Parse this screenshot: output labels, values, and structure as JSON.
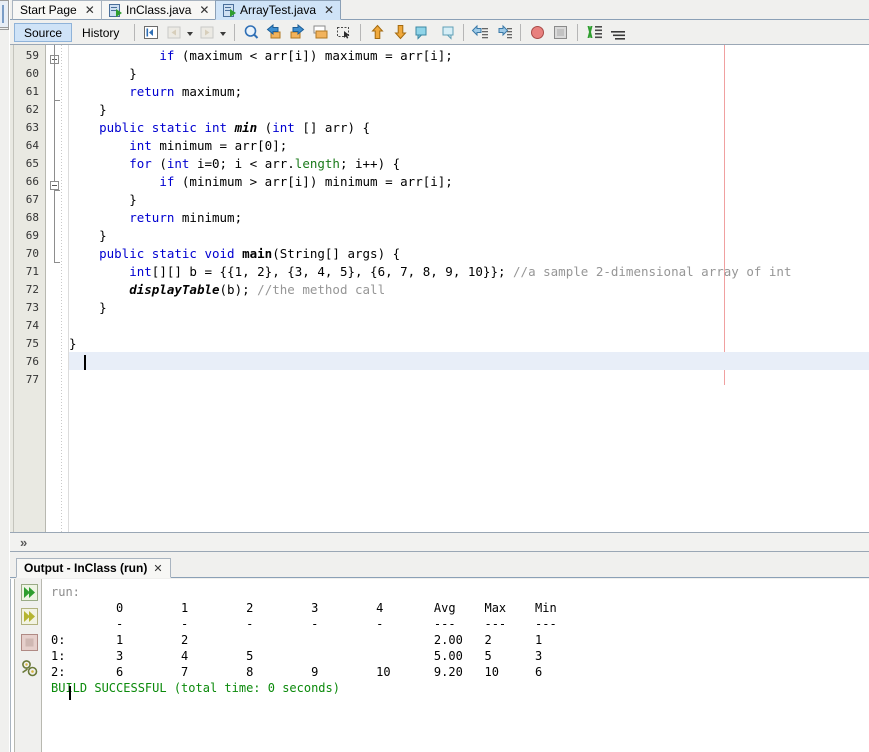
{
  "window": {
    "title": "NetBeans IDE - ArrayTest.java",
    "accent_color": "#cfe3f7",
    "gutter_color": "#e9e9e2",
    "keyword_color": "#0000d0",
    "comment_color": "#969696",
    "success_color": "#0b8a0b",
    "margin_line_color": "#f0a0a0",
    "current_line_color": "#e8eef8"
  },
  "tabs": [
    {
      "label": "Start Page",
      "icon": "none",
      "active": false,
      "close": "✕"
    },
    {
      "label": "InClass.java",
      "icon": "java-file-icon",
      "active": false,
      "close": "✕"
    },
    {
      "label": "ArrayTest.java",
      "icon": "java-file-icon",
      "active": true,
      "close": "✕"
    }
  ],
  "toolbar": {
    "source_label": "Source",
    "history_label": "History",
    "icons": [
      "last-edit-icon",
      "back-icon",
      "back-dropdown-caret",
      "forward-icon",
      "forward-dropdown-caret",
      "find-selection-icon",
      "previous-bookmark-icon",
      "next-bookmark-icon",
      "toggle-bookmark-icon",
      "rectangular-selection-icon",
      "shift-line-up-icon",
      "shift-line-down-icon",
      "comment-icon",
      "uncomment-icon",
      "shift-left-icon",
      "shift-right-icon",
      "start-macro-recording-icon",
      "stop-macro-recording-icon",
      "toggle-highlight-icon",
      "inspect-icon"
    ]
  },
  "editor": {
    "first_line_number": 59,
    "last_line_number": 77,
    "current_line": 76,
    "lines": [
      {
        "n": 59,
        "segments": [
          {
            "t": "            ",
            "c": ""
          },
          {
            "t": "if",
            "c": "kw"
          },
          {
            "t": " (maximum < arr[i]) maximum = arr[i];",
            "c": ""
          }
        ]
      },
      {
        "n": 60,
        "segments": [
          {
            "t": "        }",
            "c": ""
          }
        ]
      },
      {
        "n": 61,
        "segments": [
          {
            "t": "        ",
            "c": ""
          },
          {
            "t": "return",
            "c": "kw"
          },
          {
            "t": " maximum;",
            "c": ""
          }
        ]
      },
      {
        "n": 62,
        "segments": [
          {
            "t": "    }",
            "c": ""
          }
        ]
      },
      {
        "n": 63,
        "segments": [
          {
            "t": "    ",
            "c": ""
          },
          {
            "t": "public static int",
            "c": "kw"
          },
          {
            "t": " ",
            "c": ""
          },
          {
            "t": "min",
            "c": "bi"
          },
          {
            "t": " (",
            "c": ""
          },
          {
            "t": "int",
            "c": "kw"
          },
          {
            "t": " [] arr) {",
            "c": ""
          }
        ]
      },
      {
        "n": 64,
        "segments": [
          {
            "t": "        ",
            "c": ""
          },
          {
            "t": "int",
            "c": "kw"
          },
          {
            "t": " minimum = arr[0];",
            "c": ""
          }
        ]
      },
      {
        "n": 65,
        "segments": [
          {
            "t": "        ",
            "c": ""
          },
          {
            "t": "for",
            "c": "kw"
          },
          {
            "t": " (",
            "c": ""
          },
          {
            "t": "int",
            "c": "kw"
          },
          {
            "t": " i=0; i < arr.",
            "c": ""
          },
          {
            "t": "length",
            "c": "grn"
          },
          {
            "t": "; i++) {",
            "c": ""
          }
        ]
      },
      {
        "n": 66,
        "segments": [
          {
            "t": "            ",
            "c": ""
          },
          {
            "t": "if",
            "c": "kw"
          },
          {
            "t": " (minimum > arr[i]) minimum = arr[i];",
            "c": ""
          }
        ]
      },
      {
        "n": 67,
        "segments": [
          {
            "t": "        }",
            "c": ""
          }
        ]
      },
      {
        "n": 68,
        "segments": [
          {
            "t": "        ",
            "c": ""
          },
          {
            "t": "return",
            "c": "kw"
          },
          {
            "t": " minimum;",
            "c": ""
          }
        ]
      },
      {
        "n": 69,
        "segments": [
          {
            "t": "    }",
            "c": ""
          }
        ]
      },
      {
        "n": 70,
        "segments": [
          {
            "t": "    ",
            "c": ""
          },
          {
            "t": "public static void",
            "c": "kw"
          },
          {
            "t": " ",
            "c": ""
          },
          {
            "t": "main",
            "c": "bd"
          },
          {
            "t": "(String[] args) {",
            "c": ""
          }
        ]
      },
      {
        "n": 71,
        "segments": [
          {
            "t": "        ",
            "c": ""
          },
          {
            "t": "int",
            "c": "kw"
          },
          {
            "t": "[][] b = {{1, 2}, {3, 4, 5}, {6, 7, 8, 9, 10}}; ",
            "c": ""
          },
          {
            "t": "//a sample 2-dimensional array of int",
            "c": "cmt"
          }
        ]
      },
      {
        "n": 72,
        "segments": [
          {
            "t": "        ",
            "c": ""
          },
          {
            "t": "displayTable",
            "c": "bi"
          },
          {
            "t": "(b); ",
            "c": ""
          },
          {
            "t": "//the method call",
            "c": "cmt"
          }
        ]
      },
      {
        "n": 73,
        "segments": [
          {
            "t": "    }",
            "c": ""
          }
        ]
      },
      {
        "n": 74,
        "segments": [
          {
            "t": "",
            "c": ""
          }
        ]
      },
      {
        "n": 75,
        "segments": [
          {
            "t": "}",
            "c": ""
          }
        ]
      },
      {
        "n": 76,
        "segments": [
          {
            "t": "",
            "c": ""
          }
        ]
      },
      {
        "n": 77,
        "segments": [
          {
            "t": "",
            "c": ""
          }
        ]
      }
    ]
  },
  "breadcrumb": {
    "chevron": "»"
  },
  "output": {
    "tab_label": "Output - InClass (run)",
    "tab_close": "✕",
    "rail_icons": [
      "rerun-icon",
      "rerun-alt-icon",
      "stop-icon",
      "settings-icon"
    ],
    "lines": [
      {
        "t": "run:",
        "c": "o-run"
      },
      {
        "t": "         0        1        2        3        4       Avg    Max    Min",
        "c": ""
      },
      {
        "t": "         -        -        -        -        -       ---    ---    ---",
        "c": ""
      },
      {
        "t": "0:       1        2                                  2.00   2      1",
        "c": ""
      },
      {
        "t": "1:       3        4        5                         5.00   5      3",
        "c": ""
      },
      {
        "t": "2:       6        7        8        9        10      9.20   10     6",
        "c": ""
      },
      {
        "t": "BUILD SUCCESSFUL (total time: 0 seconds)",
        "c": "o-ok"
      }
    ],
    "table": {
      "col_headers": [
        "0",
        "1",
        "2",
        "3",
        "4",
        "Avg",
        "Max",
        "Min"
      ],
      "rows": [
        {
          "label": "0:",
          "values": [
            "1",
            "2",
            "",
            "",
            ""
          ],
          "avg": "2.00",
          "max": "2",
          "min": "1"
        },
        {
          "label": "1:",
          "values": [
            "3",
            "4",
            "5",
            "",
            ""
          ],
          "avg": "5.00",
          "max": "5",
          "min": "3"
        },
        {
          "label": "2:",
          "values": [
            "6",
            "7",
            "8",
            "9",
            "10"
          ],
          "avg": "9.20",
          "max": "10",
          "min": "6"
        }
      ],
      "build_status": "BUILD SUCCESSFUL (total time: 0 seconds)"
    }
  }
}
